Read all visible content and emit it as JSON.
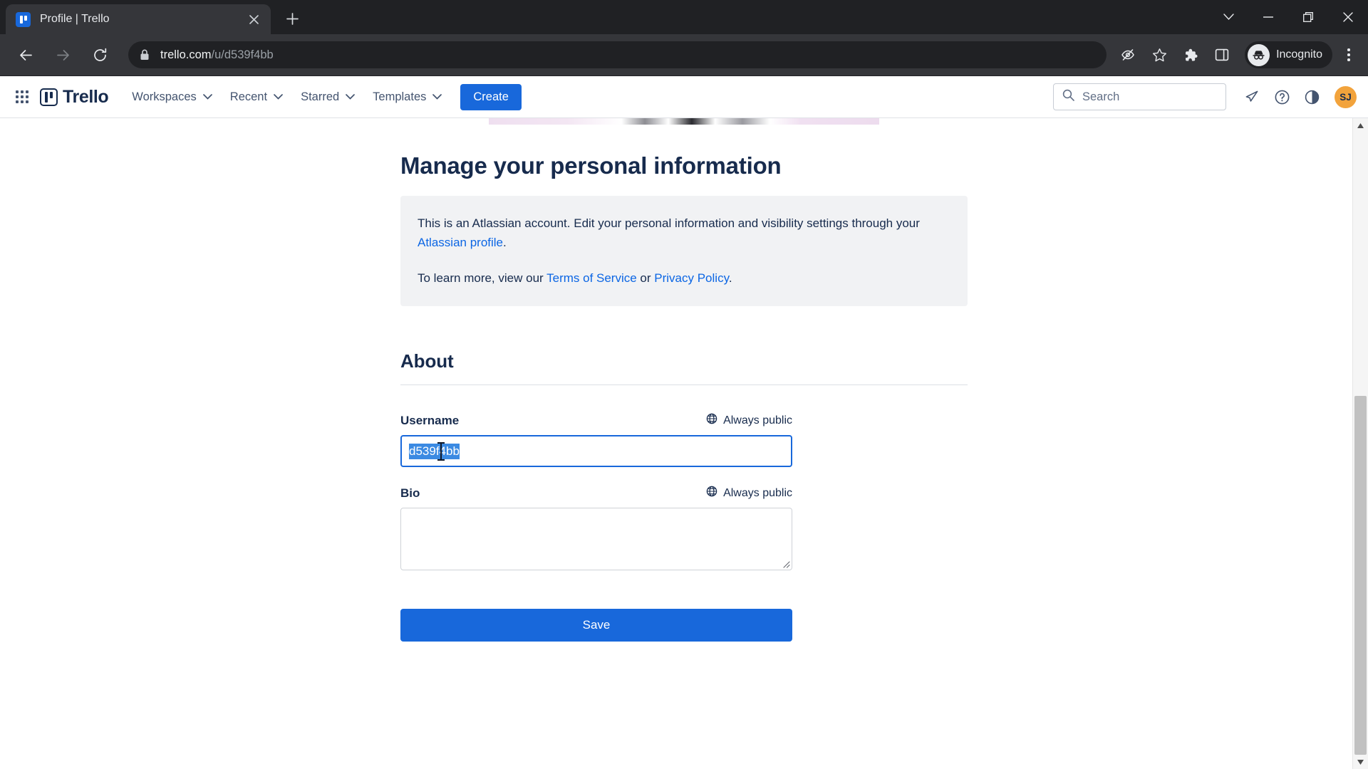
{
  "browser": {
    "tab": {
      "title": "Profile | Trello",
      "favicon": "trello-favicon",
      "close_label": "×"
    },
    "new_tab_label": "+",
    "window_controls": {
      "search_tabs": "∨",
      "minimize": "–",
      "maximize": "❐",
      "close": "✕"
    },
    "nav": {
      "back": "←",
      "forward": "→",
      "reload": "↻"
    },
    "omnibox": {
      "lock_icon": "lock-icon",
      "host": "trello.com",
      "path": "/u/d539f4bb"
    },
    "toolbar_icons": [
      "eye-slash-icon",
      "star-icon",
      "extensions-puzzle-icon",
      "side-panel-icon"
    ],
    "profile_chip": {
      "label": "Incognito",
      "avatar": "incognito-hat-icon"
    },
    "menu_label": "chrome-kebab-menu"
  },
  "trello_nav": {
    "app_switcher": "grid-apps-icon",
    "logo_text": "Trello",
    "items": [
      {
        "label": "Workspaces",
        "has_chevron": true
      },
      {
        "label": "Recent",
        "has_chevron": true
      },
      {
        "label": "Starred",
        "has_chevron": true
      },
      {
        "label": "Templates",
        "has_chevron": true
      }
    ],
    "create_label": "Create",
    "search_placeholder": "Search",
    "right_icons": [
      "notifications-bell-icon",
      "help-question-icon",
      "theme-contrast-icon"
    ],
    "avatar_initials": "SJ"
  },
  "page": {
    "title": "Manage your personal information",
    "info_panel": {
      "line1_a": "This is an Atlassian account. Edit your personal information and visibility settings through your ",
      "line1_link": "Atlassian profile",
      "line1_b": ".",
      "line2_a": "To learn more, view our ",
      "line2_link1": "Terms of Service",
      "line2_mid": " or ",
      "line2_link2": "Privacy Policy",
      "line2_b": "."
    },
    "about": {
      "heading": "About",
      "username": {
        "label": "Username",
        "visibility": "Always public",
        "visibility_icon": "globe-icon",
        "value": "d539f4bb",
        "selected": true
      },
      "bio": {
        "label": "Bio",
        "visibility": "Always public",
        "visibility_icon": "globe-icon",
        "value": "",
        "placeholder": ""
      },
      "save_label": "Save"
    }
  },
  "colors": {
    "brand_blue": "#1868db",
    "link_blue": "#0c66e4",
    "selection_blue": "#3b8ae2",
    "text_dark": "#172b4d",
    "panel_grey": "#f1f2f4",
    "avatar_orange": "#f2a33c"
  }
}
